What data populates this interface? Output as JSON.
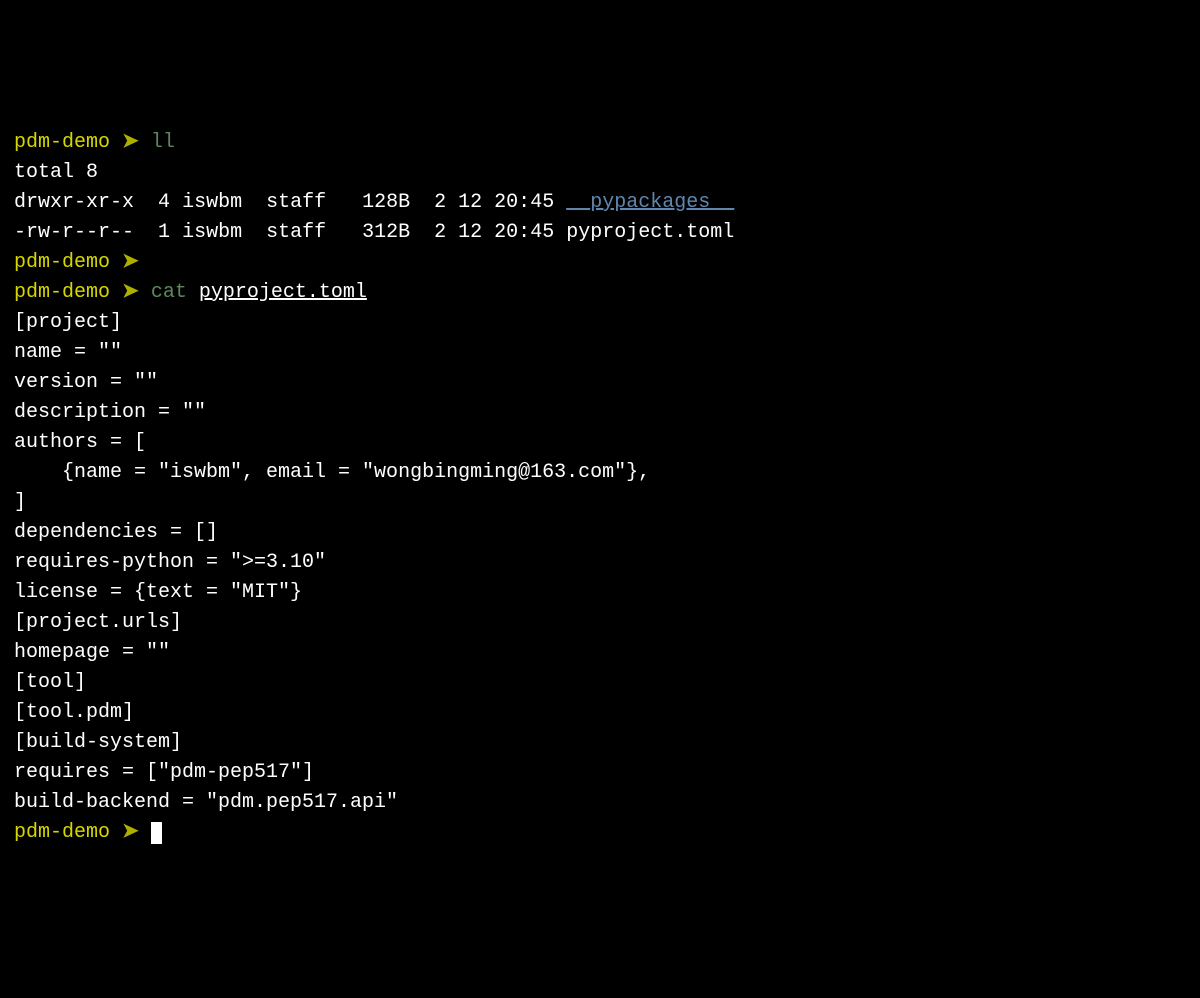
{
  "prompt": {
    "dir": "pdm-demo",
    "arrow": "➤"
  },
  "commands": {
    "ll": "ll",
    "cat": "cat",
    "cat_arg": "pyproject.toml"
  },
  "ll_output": {
    "total": "total 8",
    "row1": {
      "perms": "drwxr-xr-x",
      "links": "4",
      "owner": "iswbm",
      "group": "staff",
      "size": "128B",
      "date": "2 12 20:45",
      "name": "__pypackages__"
    },
    "row2": {
      "perms": "-rw-r--r--",
      "links": "1",
      "owner": "iswbm",
      "group": "staff",
      "size": "312B",
      "date": "2 12 20:45",
      "name": "pyproject.toml"
    }
  },
  "file": {
    "l1": "[project]",
    "l2": "name = \"\"",
    "l3": "version = \"\"",
    "l4": "description = \"\"",
    "l5": "authors = [",
    "l6": "    {name = \"iswbm\", email = \"wongbingming@163.com\"},",
    "l7": "]",
    "l8": "dependencies = []",
    "l9": "requires-python = \">=3.10\"",
    "l10": "license = {text = \"MIT\"}",
    "l11": "",
    "l12": "[project.urls]",
    "l13": "homepage = \"\"",
    "l14": "",
    "l15": "[tool]",
    "l16": "[tool.pdm]",
    "l17": "",
    "l18": "[build-system]",
    "l19": "requires = [\"pdm-pep517\"]",
    "l20": "build-backend = \"pdm.pep517.api\""
  }
}
